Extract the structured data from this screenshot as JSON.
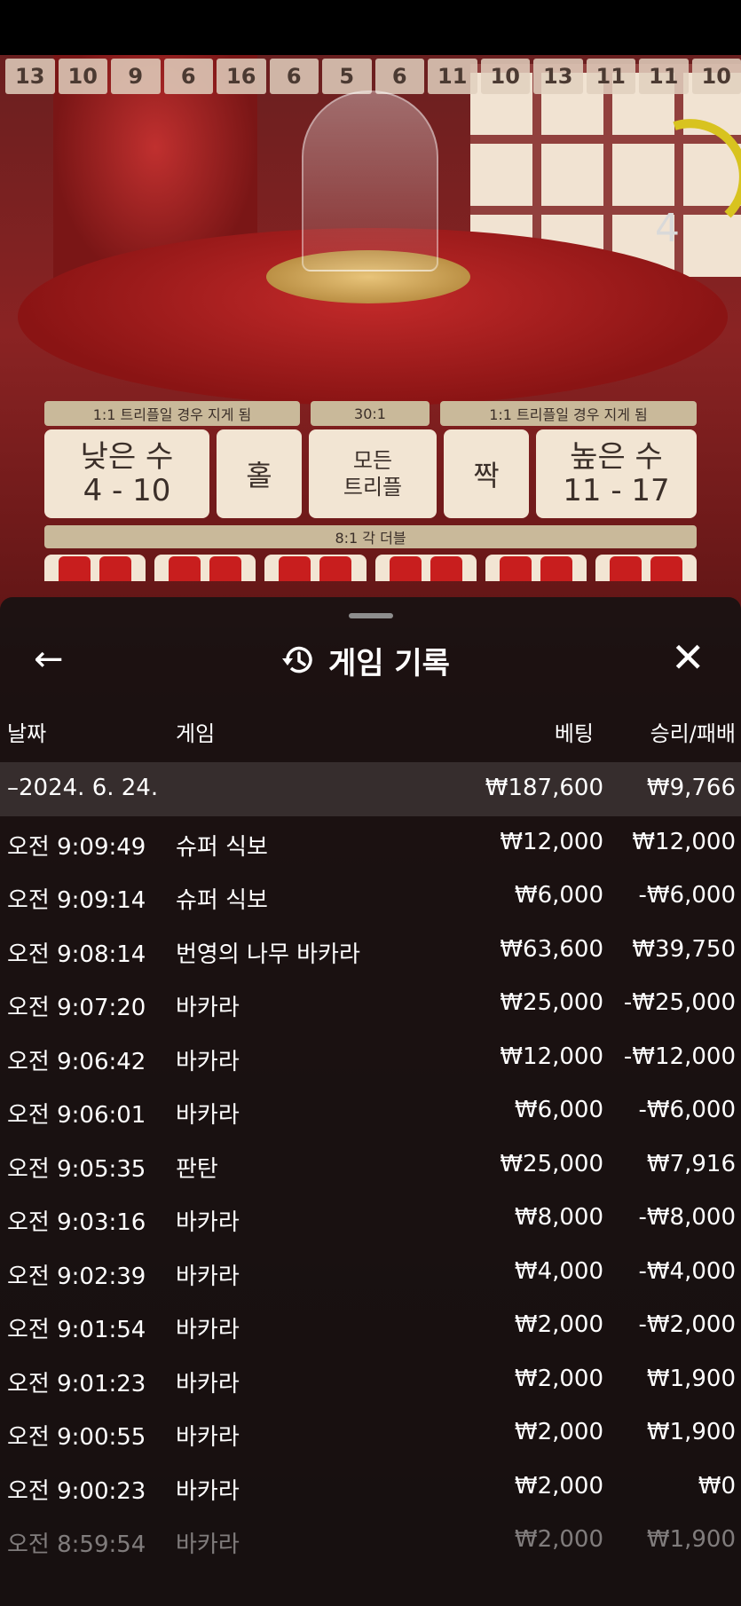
{
  "history_strip": [
    "13",
    "10",
    "9",
    "6",
    "16",
    "6",
    "5",
    "6",
    "11",
    "10",
    "13",
    "11",
    "11",
    "10"
  ],
  "timer": "4",
  "table": {
    "banner_left": "1:1 트리플일 경우 지게 됨",
    "banner_mid": "30:1",
    "banner_right": "1:1 트리플일 경우 지게 됨",
    "bets": {
      "low_label": "낮은 수",
      "low_range": "4 - 10",
      "odd": "홀",
      "any_triple_1": "모든",
      "any_triple_2": "트리플",
      "even": "짝",
      "high_label": "높은 수",
      "high_range": "11 - 17"
    },
    "double_banner": "8:1 각 더블"
  },
  "panel": {
    "title": "게임 기록",
    "back_icon": "arrow-left-icon",
    "history_icon": "history-icon",
    "close_icon": "close-icon",
    "columns": {
      "date": "날짜",
      "game": "게임",
      "bet": "베팅",
      "result": "승리/패배"
    },
    "summary": {
      "date": "–2024. 6. 24.",
      "bet": "₩187,600",
      "result": "₩9,766"
    },
    "rows": [
      {
        "time": "오전 9:09:49",
        "game": "슈퍼 식보",
        "bet": "₩12,000",
        "result": "₩12,000"
      },
      {
        "time": "오전 9:09:14",
        "game": "슈퍼 식보",
        "bet": "₩6,000",
        "result": "-₩6,000"
      },
      {
        "time": "오전 9:08:14",
        "game": "번영의 나무 바카라",
        "bet": "₩63,600",
        "result": "₩39,750"
      },
      {
        "time": "오전 9:07:20",
        "game": "바카라",
        "bet": "₩25,000",
        "result": "-₩25,000"
      },
      {
        "time": "오전 9:06:42",
        "game": "바카라",
        "bet": "₩12,000",
        "result": "-₩12,000"
      },
      {
        "time": "오전 9:06:01",
        "game": "바카라",
        "bet": "₩6,000",
        "result": "-₩6,000"
      },
      {
        "time": "오전 9:05:35",
        "game": "판탄",
        "bet": "₩25,000",
        "result": "₩7,916"
      },
      {
        "time": "오전 9:03:16",
        "game": "바카라",
        "bet": "₩8,000",
        "result": "-₩8,000"
      },
      {
        "time": "오전 9:02:39",
        "game": "바카라",
        "bet": "₩4,000",
        "result": "-₩4,000"
      },
      {
        "time": "오전 9:01:54",
        "game": "바카라",
        "bet": "₩2,000",
        "result": "-₩2,000"
      },
      {
        "time": "오전 9:01:23",
        "game": "바카라",
        "bet": "₩2,000",
        "result": "₩1,900"
      },
      {
        "time": "오전 9:00:55",
        "game": "바카라",
        "bet": "₩2,000",
        "result": "₩1,900"
      },
      {
        "time": "오전 9:00:23",
        "game": "바카라",
        "bet": "₩2,000",
        "result": "₩0"
      },
      {
        "time": "오전 8:59:54",
        "game": "바카라",
        "bet": "₩2,000",
        "result": "₩1,900"
      }
    ]
  }
}
